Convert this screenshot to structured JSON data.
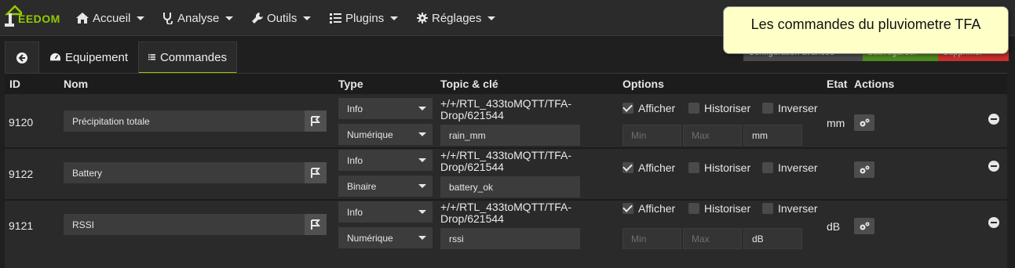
{
  "brand": "EEDOM",
  "nav": [
    "Accueil",
    "Analyse",
    "Outils",
    "Plugins",
    "Réglages"
  ],
  "callout": "Les commandes du pluviometre TFA",
  "hidden_buttons": [
    "Configuration avancée",
    "Sauvegarder",
    "Supprimer"
  ],
  "tabs": {
    "equipment": "Equipement",
    "commands": "Commandes"
  },
  "headers": {
    "id": "ID",
    "name": "Nom",
    "type": "Type",
    "topic": "Topic & clé",
    "options": "Options",
    "state": "Etat",
    "actions": "Actions"
  },
  "options_labels": {
    "show": "Afficher",
    "historize": "Historiser",
    "invert": "Inverser"
  },
  "placeholders": {
    "min": "Min",
    "max": "Max"
  },
  "rows": [
    {
      "id": "9120",
      "name": "Précipitation totale",
      "type": "Info",
      "subtype": "Numérique",
      "topic": "+/+/RTL_433toMQTT/TFA-Drop/621544",
      "key": "rain_mm",
      "unit": "mm",
      "state": "mm",
      "show": true,
      "historize": false,
      "invert": false
    },
    {
      "id": "9122",
      "name": "Battery",
      "type": "Info",
      "subtype": "Binaire",
      "topic": "+/+/RTL_433toMQTT/TFA-Drop/621544",
      "key": "battery_ok",
      "unit": "",
      "state": "",
      "show": true,
      "historize": false,
      "invert": false
    },
    {
      "id": "9121",
      "name": "RSSI",
      "type": "Info",
      "subtype": "Numérique",
      "topic": "+/+/RTL_433toMQTT/TFA-Drop/621544",
      "key": "rssi",
      "unit": "dB",
      "state": "dB",
      "show": true,
      "historize": false,
      "invert": false
    }
  ]
}
